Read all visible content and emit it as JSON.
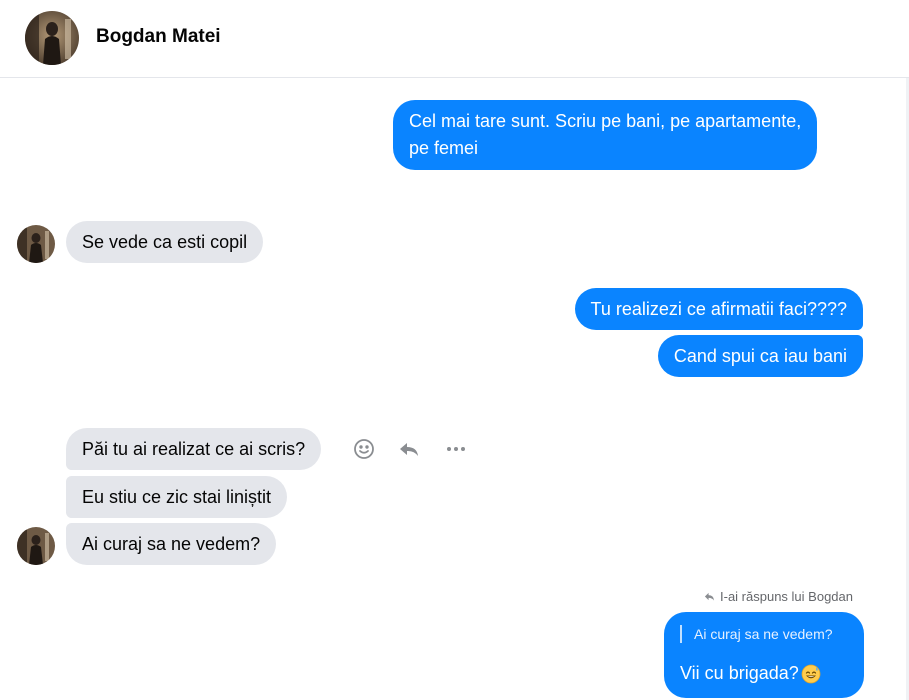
{
  "contact": {
    "name": "Bogdan Matei"
  },
  "messages": [
    {
      "side": "out",
      "lines": [
        "Cel mai tare sunt. Scriu pe bani, pe apartamente,",
        "pe femei"
      ]
    },
    {
      "side": "in",
      "text": "Se vede ca esti copil"
    },
    {
      "side": "out",
      "text": "Tu realizezi ce afirmatii faci????"
    },
    {
      "side": "out",
      "text": "Cand spui ca iau bani"
    },
    {
      "side": "in",
      "text": "Păi tu ai realizat ce ai scris?"
    },
    {
      "side": "in",
      "text": "Eu stiu ce zic stai liniștit"
    },
    {
      "side": "in",
      "text": "Ai curaj sa ne vedem?"
    }
  ],
  "hover_actions": {
    "react_icon": "smiley-icon",
    "reply_icon": "reply-arrow-icon",
    "more_icon": "more-dots-icon"
  },
  "reply": {
    "note": "I-ai răspuns lui Bogdan",
    "quoted": "Ai curaj sa ne vedem?",
    "text": "Vii cu brigada?",
    "emoji": "grinning-sweat-emoji"
  },
  "colors": {
    "outgoing": "#0a84ff",
    "incoming": "#e4e6eb",
    "secondary_text": "#65676b"
  }
}
